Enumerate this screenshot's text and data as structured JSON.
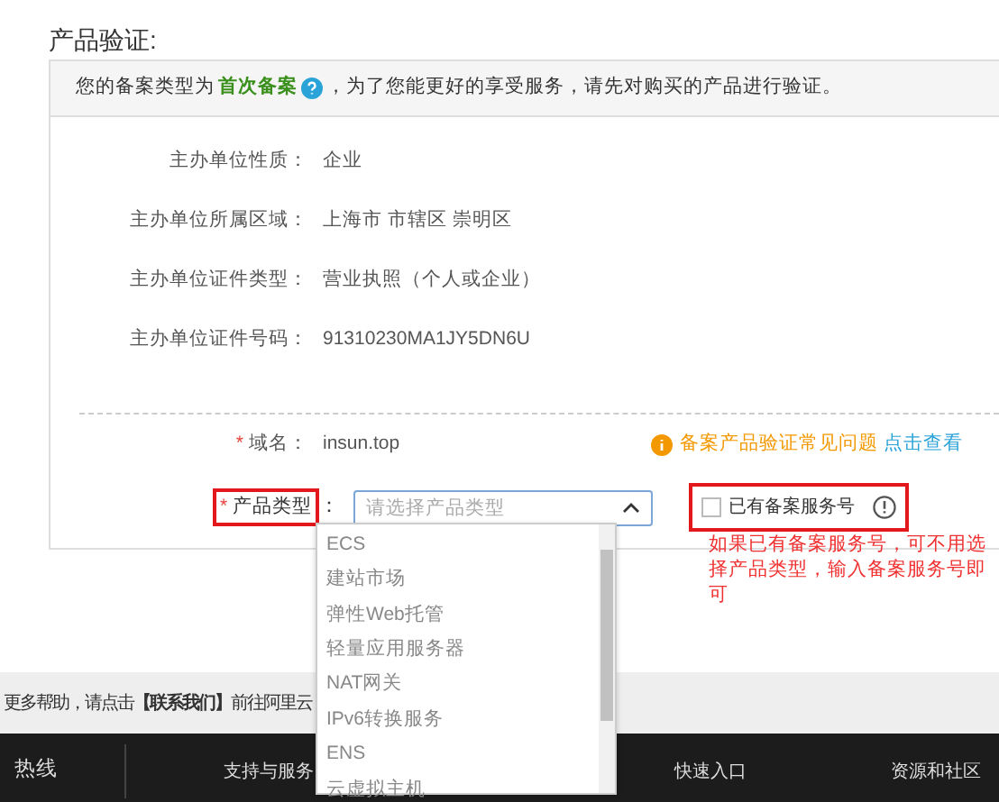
{
  "heading": "产品验证:",
  "notice": {
    "before": "您的备案类型为",
    "highlight": "首次备案",
    "after": "，为了您能更好的享受服务，请先对购买的产品进行验证。"
  },
  "info_rows": [
    {
      "label": "主办单位性质：",
      "value": "企业"
    },
    {
      "label": "主办单位所属区域：",
      "value": "上海市 市辖区 崇明区"
    },
    {
      "label": "主办单位证件类型：",
      "value": "营业执照（个人或企业）"
    },
    {
      "label": "主办单位证件号码：",
      "value": "91310230MA1JY5DN6U"
    }
  ],
  "domain": {
    "label": "域名：",
    "required_mark": "*",
    "value": "insun.top"
  },
  "faq": {
    "text": "备案产品验证常见问题",
    "link": "点击查看"
  },
  "product_type": {
    "label": "产品类型",
    "suffix": "：",
    "required_mark": "*",
    "marked": true,
    "placeholder": "请选择产品类型",
    "expanded": true,
    "options": [
      "ECS",
      "建站市场",
      "弹性Web托管",
      "轻量应用服务器",
      "NAT网关",
      "IPv6转换服务",
      "ENS",
      "云虚拟主机"
    ]
  },
  "service_number": {
    "label": "已有备案服务号",
    "checked": false,
    "marked": true
  },
  "annotation": "如果已有备案服务号，可不用选择产品类型，输入备案服务号即可",
  "help_bar": {
    "text": "更多帮助，请点击**【联系我们】**前往阿里云"
  },
  "footer": {
    "columns": [
      "热线",
      "支持与服务",
      "快速入口",
      "资源和社区"
    ]
  }
}
